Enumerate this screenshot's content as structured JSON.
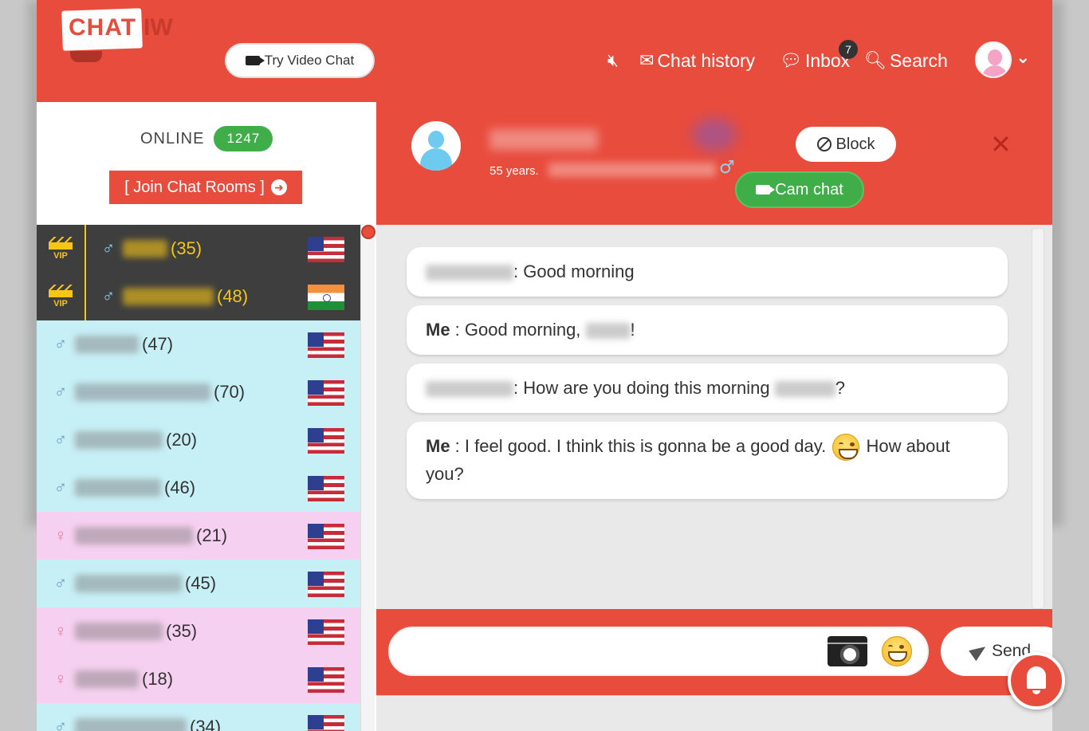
{
  "header": {
    "logo_text_1": "CHAT",
    "logo_text_2": "IW",
    "try_video_label": "Try Video Chat",
    "nav": {
      "mute_icon": "volume-mute-icon",
      "chat_history_label": "Chat history",
      "inbox_label": "Inbox",
      "inbox_count": "7",
      "search_label": "Search"
    }
  },
  "sidebar": {
    "online_label": "ONLINE",
    "online_count": "1247",
    "join_label": "[ Join Chat Rooms ]",
    "users": [
      {
        "type": "vip",
        "gender": "male",
        "age": "(35)",
        "flag": "us"
      },
      {
        "type": "vip",
        "gender": "male",
        "age": "(48)",
        "flag": "in"
      },
      {
        "type": "normal",
        "gender": "male",
        "age": "(47)",
        "flag": "us"
      },
      {
        "type": "normal",
        "gender": "male",
        "age": "(70)",
        "flag": "us"
      },
      {
        "type": "normal",
        "gender": "male",
        "age": "(20)",
        "flag": "us"
      },
      {
        "type": "normal",
        "gender": "male",
        "age": "(46)",
        "flag": "us"
      },
      {
        "type": "normal",
        "gender": "female",
        "age": "(21)",
        "flag": "us"
      },
      {
        "type": "normal",
        "gender": "male",
        "age": "(45)",
        "flag": "us"
      },
      {
        "type": "normal",
        "gender": "female",
        "age": "(35)",
        "flag": "us"
      },
      {
        "type": "normal",
        "gender": "female",
        "age": "(18)",
        "flag": "us"
      },
      {
        "type": "normal",
        "gender": "male",
        "age": "(34)",
        "flag": "us"
      }
    ],
    "vip_label": "VIP"
  },
  "chat": {
    "peer_age": "55 years.",
    "block_label": "Block",
    "cam_chat_label": "Cam chat",
    "close_glyph": "✕",
    "messages": [
      {
        "sender": "",
        "text": ": Good morning"
      },
      {
        "sender": "Me",
        "text": " : Good morning, ",
        "after": "!"
      },
      {
        "sender": "",
        "text": ": How are you doing this morning ",
        "after": "?"
      },
      {
        "sender": "Me",
        "text": " : I feel good. I think this is gonna be a good day. ",
        "after": " How about you?"
      }
    ]
  },
  "compose": {
    "send_label": "Send"
  },
  "colors": {
    "brand_red": "#e84c3d",
    "online_green": "#3fae49",
    "male_row": "#c7eff6",
    "female_row": "#f6d0f0",
    "vip_row": "#3e3e3e",
    "vip_gold": "#f5c518"
  }
}
